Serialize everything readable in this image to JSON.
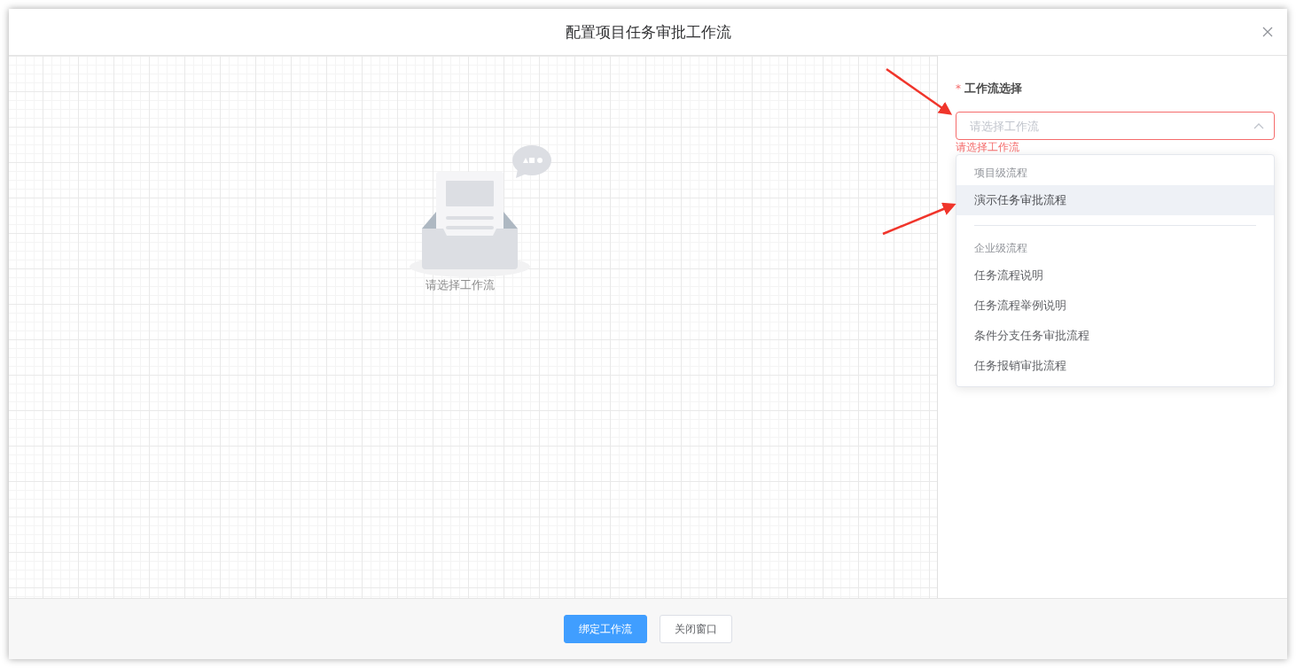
{
  "dialog": {
    "title": "配置项目任务审批工作流"
  },
  "canvas": {
    "empty_text": "请选择工作流"
  },
  "form": {
    "label": "工作流选择",
    "required_mark": "*",
    "placeholder": "请选择工作流",
    "open": true,
    "error": "请选择工作流"
  },
  "dropdown": {
    "groups": [
      {
        "label": "项目级流程",
        "options": [
          {
            "label": "演示任务审批流程",
            "highlighted": true
          }
        ]
      },
      {
        "label": "企业级流程",
        "options": [
          {
            "label": "任务流程说明",
            "highlighted": false
          },
          {
            "label": "任务流程举例说明",
            "highlighted": false
          },
          {
            "label": "条件分支任务审批流程",
            "highlighted": false
          },
          {
            "label": "任务报销审批流程",
            "highlighted": false
          }
        ]
      }
    ]
  },
  "buttons": [
    {
      "label": "绑定工作流",
      "kind": "primary"
    },
    {
      "label": "关闭窗口",
      "kind": "default"
    }
  ]
}
